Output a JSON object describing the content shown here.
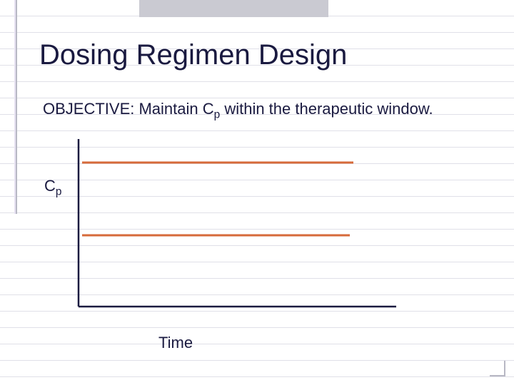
{
  "title": "Dosing Regimen Design",
  "objective": {
    "prefix": "OBJECTIVE:  Maintain C",
    "sub": "p",
    "suffix": " within the therapeutic window."
  },
  "chart_data": {
    "type": "line",
    "title": "",
    "xlabel": "Time",
    "ylabel": "Cp",
    "axes": {
      "x_line": {
        "x1": 110,
        "y1": 430,
        "x2": 555,
        "y2": 430
      },
      "y_line": {
        "x1": 110,
        "y1": 195,
        "x2": 110,
        "y2": 430
      }
    },
    "reference_lines": [
      {
        "name": "upper-therapeutic",
        "x1": 115,
        "y1": 228,
        "x2": 495,
        "y2": 228,
        "color": "#d66a3a"
      },
      {
        "name": "lower-therapeutic",
        "x1": 115,
        "y1": 330,
        "x2": 490,
        "y2": 330,
        "color": "#d66a3a"
      }
    ],
    "series": []
  }
}
